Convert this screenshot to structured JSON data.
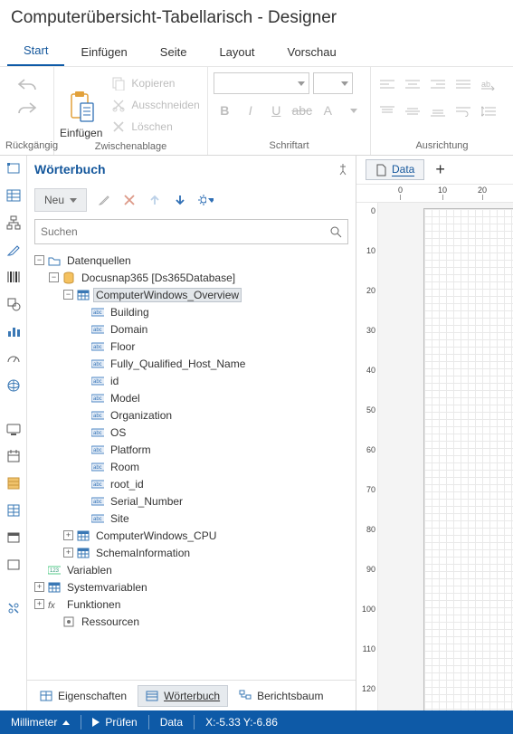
{
  "title": "Computerübersicht-Tabellarisch - Designer",
  "tabs": {
    "start": "Start",
    "einfuegen": "Einfügen",
    "seite": "Seite",
    "layout": "Layout",
    "vorschau": "Vorschau"
  },
  "ribbon": {
    "undo_group": "Rückgängig",
    "clipboard_group": "Zwischenablage",
    "font_group": "Schriftart",
    "align_group": "Ausrichtung",
    "paste": "Einfügen",
    "copy": "Kopieren",
    "cut": "Ausschneiden",
    "delete": "Löschen"
  },
  "panel": {
    "title": "Wörterbuch",
    "neu": "Neu",
    "search_placeholder": "Suchen",
    "tabs": {
      "eigenschaften": "Eigenschaften",
      "woerterbuch": "Wörterbuch",
      "berichtsbaum": "Berichtsbaum"
    }
  },
  "tree": {
    "root": "Datenquellen",
    "db": "Docusnap365 [Ds365Database]",
    "overview": "ComputerWindows_Overview",
    "fields": [
      "Building",
      "Domain",
      "Floor",
      "Fully_Qualified_Host_Name",
      "id",
      "Model",
      "Organization",
      "OS",
      "Platform",
      "Room",
      "root_id",
      "Serial_Number",
      "Site"
    ],
    "cpu": "ComputerWindows_CPU",
    "schema": "SchemaInformation",
    "vars": "Variablen",
    "sysvars": "Systemvariablen",
    "funcs": "Funktionen",
    "res": "Ressourcen"
  },
  "canvas": {
    "tab": "Data"
  },
  "ruler_h": [
    0,
    10,
    20
  ],
  "ruler_v": [
    0,
    10,
    20,
    30,
    40,
    50,
    60,
    70,
    80,
    90,
    100,
    110,
    120
  ],
  "status": {
    "unit": "Millimeter",
    "check": "Prüfen",
    "data": "Data",
    "coords": "X:-5.33 Y:-6.86"
  }
}
